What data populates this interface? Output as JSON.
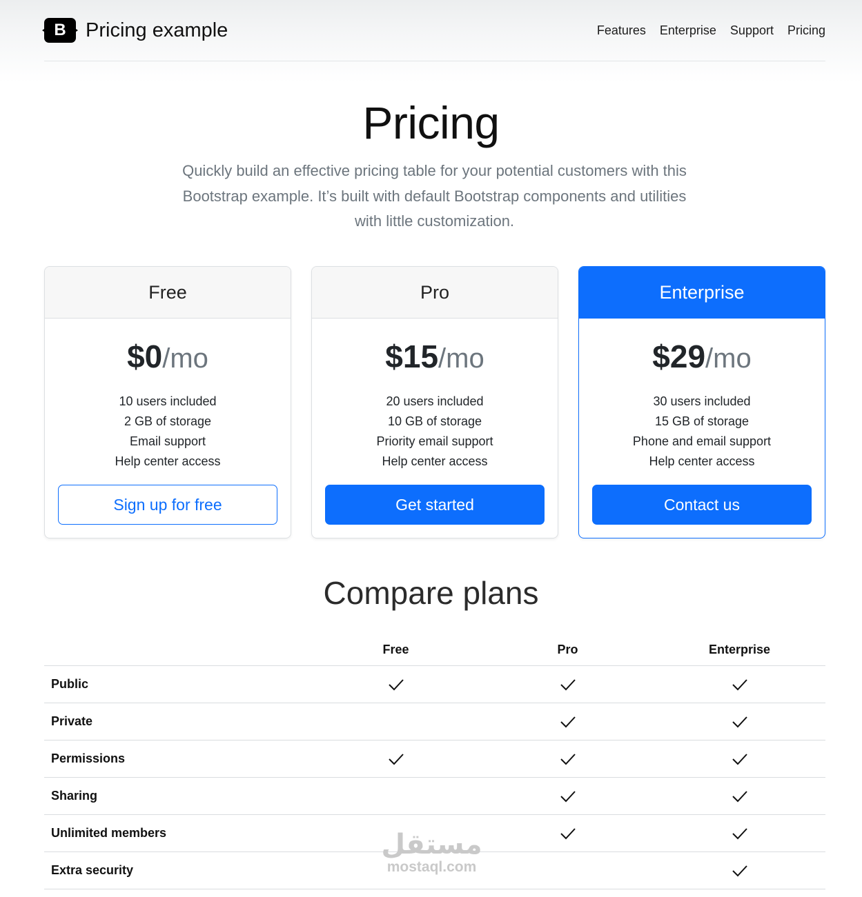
{
  "header": {
    "logo_letter": "B",
    "title": "Pricing example",
    "nav": [
      "Features",
      "Enterprise",
      "Support",
      "Pricing"
    ]
  },
  "hero": {
    "title": "Pricing",
    "lead": "Quickly build an effective pricing table for your potential customers with this Bootstrap example. It’s built with default Bootstrap components and utilities with little customization."
  },
  "plans": [
    {
      "name": "Free",
      "price": "$0",
      "unit": "/mo",
      "features": [
        "10 users included",
        "2 GB of storage",
        "Email support",
        "Help center access"
      ],
      "button": "Sign up for free"
    },
    {
      "name": "Pro",
      "price": "$15",
      "unit": "/mo",
      "features": [
        "20 users included",
        "10 GB of storage",
        "Priority email support",
        "Help center access"
      ],
      "button": "Get started"
    },
    {
      "name": "Enterprise",
      "price": "$29",
      "unit": "/mo",
      "features": [
        "30 users included",
        "15 GB of storage",
        "Phone and email support",
        "Help center access"
      ],
      "button": "Contact us"
    }
  ],
  "compare": {
    "title": "Compare plans",
    "columns": [
      "Free",
      "Pro",
      "Enterprise"
    ],
    "rows": [
      {
        "feature": "Public",
        "free": true,
        "pro": true,
        "enterprise": true
      },
      {
        "feature": "Private",
        "free": false,
        "pro": true,
        "enterprise": true
      },
      {
        "feature": "Permissions",
        "free": true,
        "pro": true,
        "enterprise": true
      },
      {
        "feature": "Sharing",
        "free": false,
        "pro": true,
        "enterprise": true
      },
      {
        "feature": "Unlimited members",
        "free": false,
        "pro": true,
        "enterprise": true
      },
      {
        "feature": "Extra security",
        "free": false,
        "pro": false,
        "enterprise": true
      }
    ]
  },
  "watermark": {
    "arabic": "مستقل",
    "latin": "mostaql.com"
  },
  "colors": {
    "primary": "#0d6efd",
    "muted": "#6c757d"
  },
  "icons": {
    "check": "check-icon",
    "logo": "bootstrap-logo-icon"
  }
}
